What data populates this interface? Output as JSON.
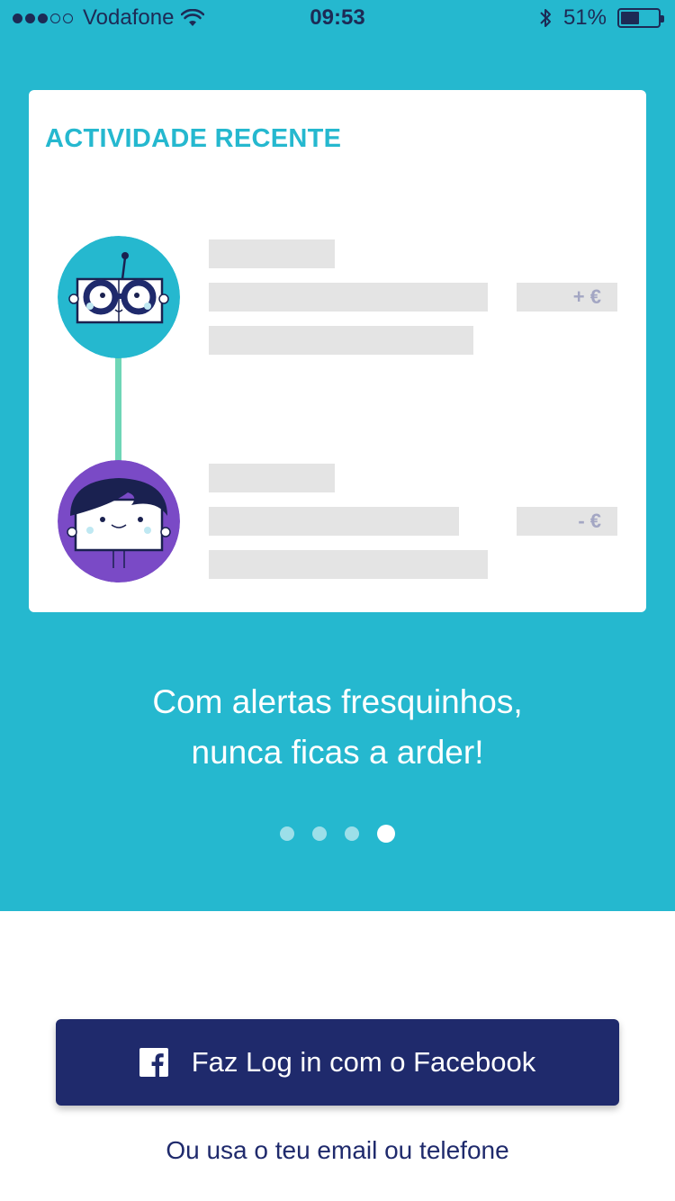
{
  "status_bar": {
    "carrier": "Vodafone",
    "time": "09:53",
    "battery_percent": "51%",
    "battery_level": 0.51,
    "signal_bars_filled": 3,
    "signal_bars_total": 5,
    "icons": [
      "signal-dots-icon",
      "wifi-icon",
      "bluetooth-icon",
      "battery-icon"
    ]
  },
  "card": {
    "title": "ACTIVIDADE RECENTE",
    "items": [
      {
        "avatar": "robot-glasses-avatar",
        "amount": "+ €"
      },
      {
        "avatar": "dark-hair-avatar",
        "amount": "- €"
      }
    ]
  },
  "tagline": {
    "line1": "Com alertas fresquinhos,",
    "line2": "nunca ficas a arder!"
  },
  "pager": {
    "count": 4,
    "active_index": 3
  },
  "facebook_button": {
    "label": "Faz Log in com o Facebook",
    "icon": "facebook-icon"
  },
  "alt_login": {
    "label": "Ou usa o teu email ou telefone"
  },
  "colors": {
    "brand": "#25b8cf",
    "navy": "#1f2a6c",
    "connector": "#6fd6b6",
    "avatar_purple": "#7a4ac6",
    "placeholder": "#e4e4e4"
  }
}
